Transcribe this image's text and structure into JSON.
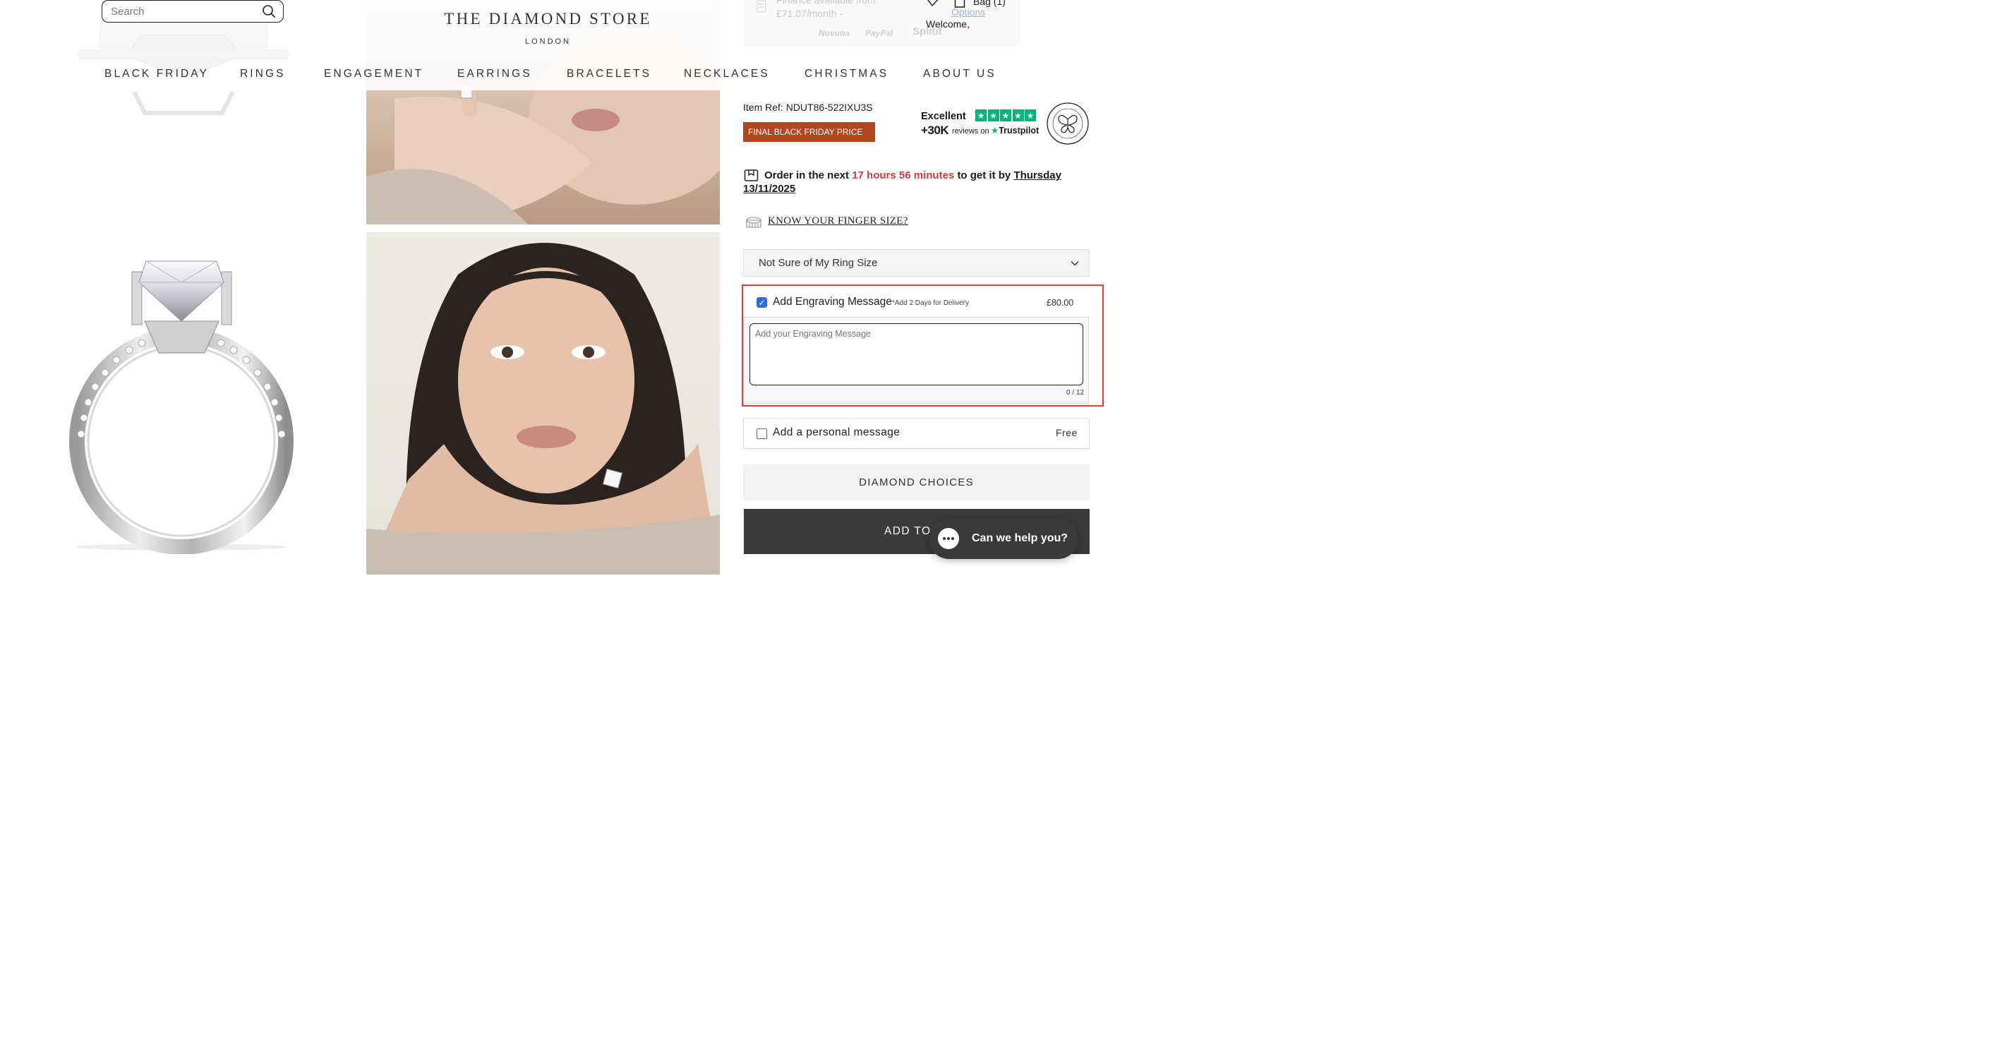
{
  "header": {
    "search": {
      "placeholder": "Search"
    },
    "brand": {
      "name": "THE DIAMOND STORE",
      "city": "LONDON"
    },
    "nav": [
      "BLACK FRIDAY",
      "RINGS",
      "ENGAGEMENT",
      "EARRINGS",
      "BRACELETS",
      "NECKLACES",
      "CHRISTMAS",
      "ABOUT US"
    ],
    "bag_label": "Bag (1)",
    "welcome": "Welcome,"
  },
  "finance": {
    "line1": "Finance available from",
    "line2": "£71.07/month -",
    "options_link": "Options",
    "providers": [
      "Novuna",
      "PayPal",
      "Splitit"
    ]
  },
  "product": {
    "item_ref_label": "Item Ref:",
    "item_ref": "NDUT86-522IXU3S",
    "badge": "FINAL BLACK FRIDAY PRICE"
  },
  "trustpilot": {
    "rating_word": "Excellent",
    "count": "+30K",
    "reviews_text": "reviews on",
    "brand": "Trustpilot",
    "stars": 5
  },
  "delivery": {
    "prefix": "Order in the next",
    "time": "17 hours 56 minutes",
    "middle": "to get it by",
    "date": "Thursday 13/11/2025"
  },
  "finger_size": {
    "label": "KNOW YOUR FINGER SIZE?"
  },
  "ring_size": {
    "selected": "Not Sure of My Ring Size"
  },
  "engraving": {
    "checked": true,
    "label": "Add Engraving Message",
    "note": "*Add 2 Days for Delivery",
    "price": "£80.00",
    "placeholder": "Add your Engraving Message",
    "char_count": "0 / 12"
  },
  "personal_message": {
    "checked": false,
    "label": "Add a personal message",
    "price": "Free"
  },
  "buttons": {
    "diamond_choices": "DIAMOND CHOICES",
    "add_to_bag": "ADD TO B"
  },
  "chat": {
    "label": "Can we help you?"
  },
  "colors": {
    "badge_bg": "#b3461e",
    "urgent_red": "#d43a3a",
    "highlight": "#e2402f",
    "trustpilot_green": "#00b67a",
    "checkbox_blue": "#2f6fdb",
    "dark_button": "#3a3a3a"
  }
}
